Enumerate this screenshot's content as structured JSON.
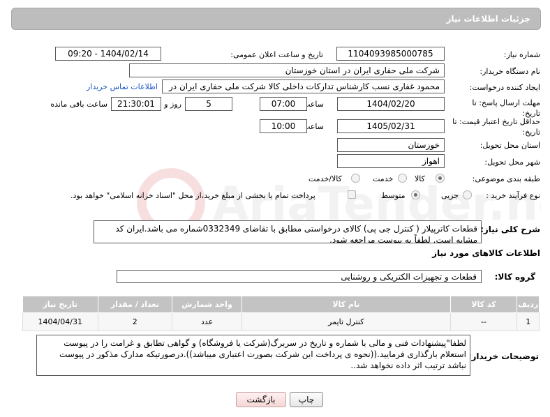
{
  "header": {
    "title": "جزئیات اطلاعات نیاز"
  },
  "fields": {
    "need_number_label": "شماره نیاز:",
    "need_number": "1104093985000785",
    "announce_label": "تاریخ و ساعت اعلان عمومی:",
    "announce_value": "1404/02/14 - 09:20",
    "buyer_org_label": "نام دستگاه خریدار:",
    "buyer_org": "شرکت ملی حفاری ایران در استان خوزستان",
    "creator_label": "ایجاد کننده درخواست:",
    "creator": "محمود غفاری نسب کارشناس تدارکات داخلی  کالا شرکت ملی حفاری ایران در",
    "contact_link": "اطلاعات تماس خریدار",
    "reply_deadline_label": "مهلت ارسال پاسخ: تا تاریخ:",
    "reply_date": "1404/02/20",
    "time_label": "ساعت",
    "reply_time": "07:00",
    "days_value": "5",
    "days_label": "روز و",
    "remaining_time": "21:30:01",
    "remaining_label": "ساعت باقی مانده",
    "price_valid_label": "حداقل تاریخ اعتبار قیمت: تا تاریخ:",
    "price_valid_date": "1405/02/31",
    "price_valid_time_label": "ساعت",
    "price_valid_time": "10:00",
    "province_label": "استان محل تحویل:",
    "province": "خوزستان",
    "city_label": "شهر محل تحویل:",
    "city": "اهواز",
    "category_label": "طبقه بندی موضوعی:",
    "category_goods": "کالا",
    "category_service": "خدمت",
    "category_both": "کالا/خدمت",
    "process_label": "نوع فرآیند خرید :",
    "process_minor": "جزیی",
    "process_medium": "متوسط",
    "payment_note": "پرداخت تمام یا بخشی از مبلغ خرید،از محل \"اسناد خزانه اسلامی\" خواهد بود."
  },
  "description": {
    "label": "شرح کلی نیاز:",
    "text": "قطعات کاترپیلار ( کنترل جی پی) کالای درخواستی مطابق با تقاضای 0332349شماره می باشد.ایران کد مشابه است. لطفاً به پیوست مراجعه شود."
  },
  "goods_section": {
    "title": "اطلاعات کالاهای مورد نیاز",
    "group_label": "گروه کالا:",
    "group_value": "قطعات و تجهیزات الکتریکی و روشنایی"
  },
  "table": {
    "headers": [
      "ردیف",
      "کد کالا",
      "نام کالا",
      "واحد شمارش",
      "تعداد / مقدار",
      "تاریخ نیاز"
    ],
    "rows": [
      [
        "1",
        "--",
        "کنترل تایمر",
        "عدد",
        "2",
        "1404/04/31"
      ]
    ]
  },
  "buyer_notes": {
    "label": "توضیحات خریدار:",
    "text": "لطفا\"پیشنهادات فنی و مالی با شماره و تاریخ در سربرگ(شرکت یا فروشگاه) و گواهی تطابق و غرامت را در پیوست استعلام بارگذاری فرمایید.((نحوه ی پرداخت این شرکت بصورت اعتباری میباشد)).درصورتیکه مدارک مذکور در پیوست نباشد ترتیب اثر داده نخواهد شد.."
  },
  "buttons": {
    "print": "چاپ",
    "back": "بازگشت"
  },
  "watermark": {
    "text": "AriaTender.neT"
  },
  "colors": {
    "header": "#bdbdbd",
    "link": "#1a55c7",
    "table_header": "#c3c3c3"
  }
}
